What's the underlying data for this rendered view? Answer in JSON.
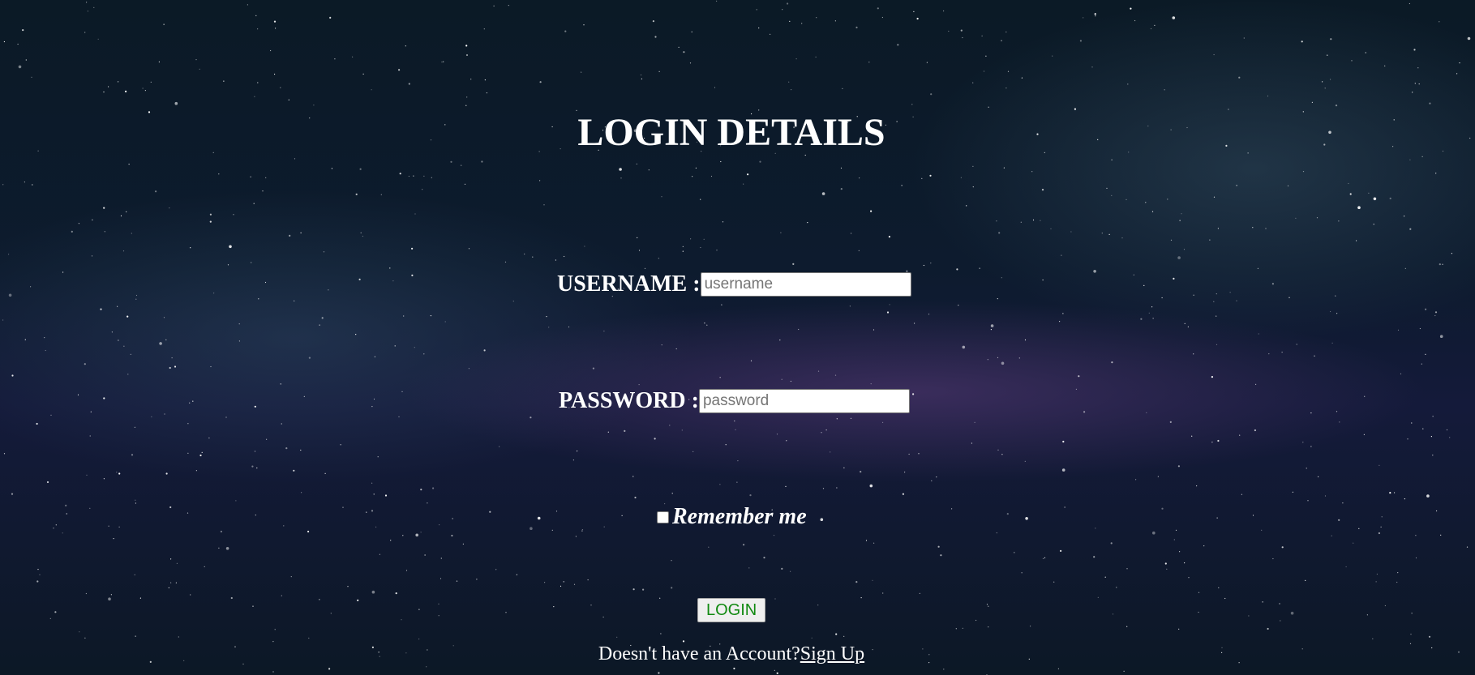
{
  "page": {
    "title": "LOGIN DETAILS"
  },
  "form": {
    "username_label": "USERNAME :",
    "username_placeholder": "username",
    "username_value": "",
    "password_label": "PASSWORD :",
    "password_placeholder": "password",
    "password_value": "",
    "remember_label": "Remember me",
    "remember_checked": false,
    "login_label": "LOGIN"
  },
  "footer": {
    "prompt": "Doesn't have an Account?",
    "signup_label": "Sign Up"
  },
  "colors": {
    "text": "#ffffff",
    "login_text": "#118a11",
    "background": "#0d1b2e"
  }
}
